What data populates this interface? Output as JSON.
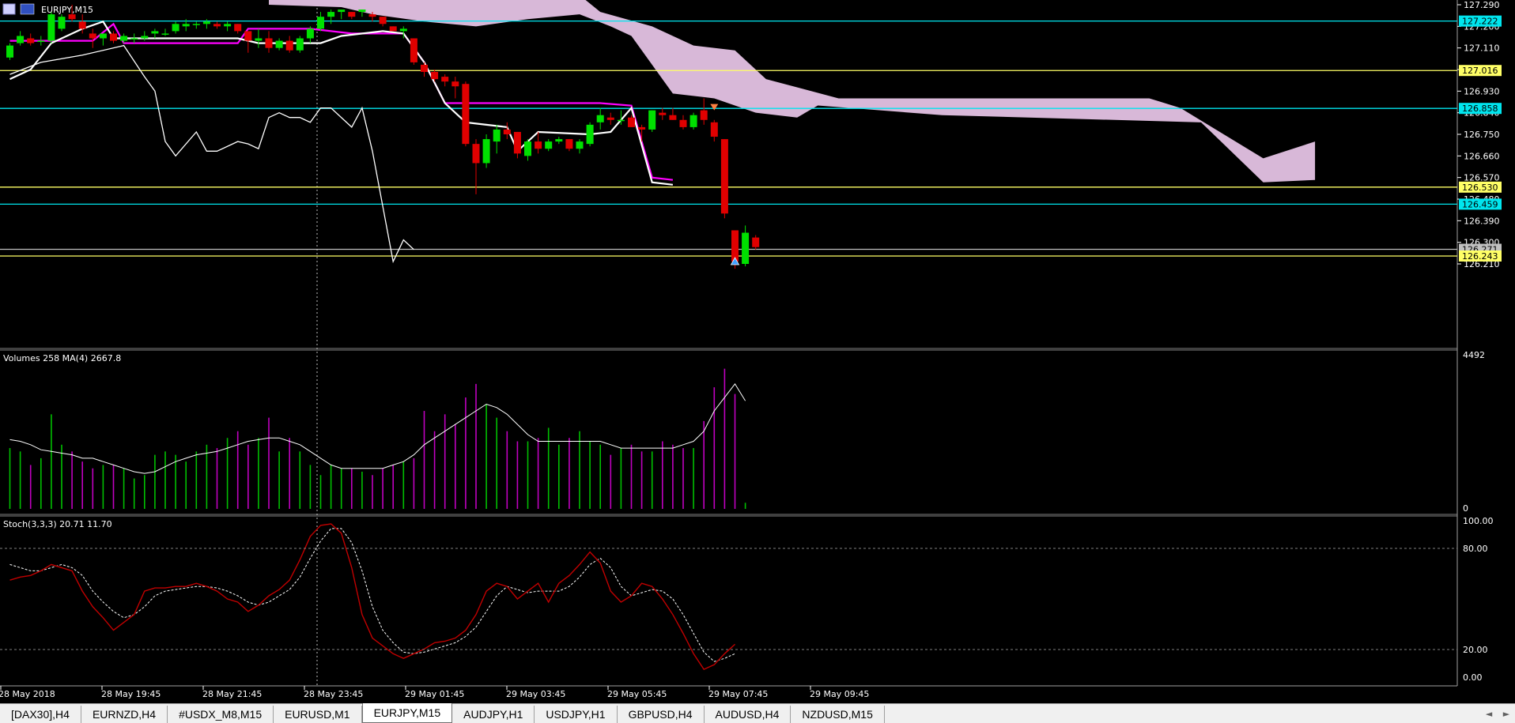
{
  "window": {
    "title": "EURJPY,M15"
  },
  "colors": {
    "bull": "#00e000",
    "bear": "#e00000",
    "kijun": "#ff00ff",
    "tenkan": "#ffffff",
    "chikou": "#ffffff",
    "cloud": "#d8b8d8",
    "cyan_level": "#00e5ee",
    "yellow_level": "#ffff66",
    "vol_bull": "#00c000",
    "vol_bear": "#c000c0",
    "stoch_main": "#c00000",
    "stoch_signal": "#ffffff"
  },
  "price_axis": {
    "ticks": [
      "127.290",
      "127.200",
      "127.110",
      "127.020",
      "126.930",
      "126.840",
      "126.750",
      "126.660",
      "126.570",
      "126.480",
      "126.390",
      "126.300",
      "126.210"
    ],
    "tags": [
      {
        "label": "127.222",
        "color": "#00e5ee"
      },
      {
        "label": "127.016",
        "color": "#ffff66"
      },
      {
        "label": "126.858",
        "color": "#00e5ee"
      },
      {
        "label": "126.530",
        "color": "#ffff66"
      },
      {
        "label": "126.459",
        "color": "#00e5ee"
      },
      {
        "label": "126.271",
        "color": "#c0c0c0"
      },
      {
        "label": "126.243",
        "color": "#ffff66"
      }
    ]
  },
  "volume_panel": {
    "label": "Volumes 258 MA(4) 2667.8",
    "max_label": "4492",
    "min_label": "0"
  },
  "stoch_panel": {
    "label": "Stoch(3,3,3) 20.71 11.70",
    "levels": [
      "100.00",
      "80.00",
      "20.00",
      "0.00"
    ]
  },
  "time_axis": [
    "28 May 2018",
    "28 May 19:45",
    "28 May 21:45",
    "28 May 23:45",
    "29 May 01:45",
    "29 May 03:45",
    "29 May 05:45",
    "29 May 07:45",
    "29 May 09:45"
  ],
  "tabs": [
    {
      "label": "[DAX30],H4",
      "active": false
    },
    {
      "label": "EURNZD,H4",
      "active": false
    },
    {
      "label": "#USDX_M8,M15",
      "active": false
    },
    {
      "label": "EURUSD,M1",
      "active": false
    },
    {
      "label": "EURJPY,M15",
      "active": true
    },
    {
      "label": "AUDJPY,H1",
      "active": false
    },
    {
      "label": "USDJPY,H1",
      "active": false
    },
    {
      "label": "GBPUSD,H4",
      "active": false
    },
    {
      "label": "AUDUSD,H4",
      "active": false
    },
    {
      "label": "NZDUSD,M15",
      "active": false
    }
  ],
  "tab_nav": {
    "left": "◄",
    "right": "►"
  },
  "chart_data": {
    "type": "candlestick",
    "title": "EURJPY,M15",
    "ylim": [
      126.17,
      127.33
    ],
    "candles": [
      {
        "o": 127.07,
        "h": 127.13,
        "l": 127.06,
        "c": 127.12
      },
      {
        "o": 127.13,
        "h": 127.18,
        "l": 127.12,
        "c": 127.16
      },
      {
        "o": 127.15,
        "h": 127.17,
        "l": 127.12,
        "c": 127.13
      },
      {
        "o": 127.14,
        "h": 127.16,
        "l": 127.12,
        "c": 127.14
      },
      {
        "o": 127.14,
        "h": 127.26,
        "l": 127.13,
        "c": 127.25
      },
      {
        "o": 127.19,
        "h": 127.25,
        "l": 127.18,
        "c": 127.24
      },
      {
        "o": 127.25,
        "h": 127.29,
        "l": 127.22,
        "c": 127.23
      },
      {
        "o": 127.22,
        "h": 127.25,
        "l": 127.17,
        "c": 127.19
      },
      {
        "o": 127.17,
        "h": 127.19,
        "l": 127.11,
        "c": 127.15
      },
      {
        "o": 127.15,
        "h": 127.17,
        "l": 127.12,
        "c": 127.17
      },
      {
        "o": 127.17,
        "h": 127.18,
        "l": 127.13,
        "c": 127.14
      },
      {
        "o": 127.14,
        "h": 127.17,
        "l": 127.13,
        "c": 127.16
      },
      {
        "o": 127.15,
        "h": 127.17,
        "l": 127.13,
        "c": 127.15
      },
      {
        "o": 127.15,
        "h": 127.18,
        "l": 127.14,
        "c": 127.16
      },
      {
        "o": 127.17,
        "h": 127.19,
        "l": 127.15,
        "c": 127.18
      },
      {
        "o": 127.17,
        "h": 127.19,
        "l": 127.16,
        "c": 127.17
      },
      {
        "o": 127.18,
        "h": 127.22,
        "l": 127.17,
        "c": 127.21
      },
      {
        "o": 127.2,
        "h": 127.23,
        "l": 127.18,
        "c": 127.21
      },
      {
        "o": 127.21,
        "h": 127.22,
        "l": 127.19,
        "c": 127.21
      },
      {
        "o": 127.21,
        "h": 127.23,
        "l": 127.19,
        "c": 127.22
      },
      {
        "o": 127.21,
        "h": 127.22,
        "l": 127.19,
        "c": 127.2
      },
      {
        "o": 127.2,
        "h": 127.22,
        "l": 127.18,
        "c": 127.21
      },
      {
        "o": 127.21,
        "h": 127.21,
        "l": 127.17,
        "c": 127.18
      },
      {
        "o": 127.18,
        "h": 127.18,
        "l": 127.09,
        "c": 127.14
      },
      {
        "o": 127.14,
        "h": 127.19,
        "l": 127.11,
        "c": 127.15
      },
      {
        "o": 127.15,
        "h": 127.18,
        "l": 127.09,
        "c": 127.11
      },
      {
        "o": 127.11,
        "h": 127.15,
        "l": 127.1,
        "c": 127.14
      },
      {
        "o": 127.14,
        "h": 127.16,
        "l": 127.09,
        "c": 127.1
      },
      {
        "o": 127.1,
        "h": 127.16,
        "l": 127.09,
        "c": 127.15
      },
      {
        "o": 127.15,
        "h": 127.2,
        "l": 127.13,
        "c": 127.19
      },
      {
        "o": 127.19,
        "h": 127.26,
        "l": 127.18,
        "c": 127.24
      },
      {
        "o": 127.24,
        "h": 127.27,
        "l": 127.21,
        "c": 127.26
      },
      {
        "o": 127.26,
        "h": 127.27,
        "l": 127.23,
        "c": 127.27
      },
      {
        "o": 127.26,
        "h": 127.26,
        "l": 127.23,
        "c": 127.24
      },
      {
        "o": 127.26,
        "h": 127.27,
        "l": 127.24,
        "c": 127.27
      },
      {
        "o": 127.25,
        "h": 127.26,
        "l": 127.22,
        "c": 127.24
      },
      {
        "o": 127.24,
        "h": 127.24,
        "l": 127.2,
        "c": 127.21
      },
      {
        "o": 127.2,
        "h": 127.2,
        "l": 127.18,
        "c": 127.18
      },
      {
        "o": 127.18,
        "h": 127.2,
        "l": 127.15,
        "c": 127.19
      },
      {
        "o": 127.15,
        "h": 127.15,
        "l": 127.04,
        "c": 127.05
      },
      {
        "o": 127.04,
        "h": 127.05,
        "l": 126.99,
        "c": 127.01
      },
      {
        "o": 127.01,
        "h": 127.02,
        "l": 126.97,
        "c": 126.98
      },
      {
        "o": 126.99,
        "h": 127.0,
        "l": 126.95,
        "c": 126.97
      },
      {
        "o": 126.97,
        "h": 126.99,
        "l": 126.9,
        "c": 126.95
      },
      {
        "o": 126.96,
        "h": 126.97,
        "l": 126.7,
        "c": 126.71
      },
      {
        "o": 126.71,
        "h": 126.73,
        "l": 126.5,
        "c": 126.63
      },
      {
        "o": 126.63,
        "h": 126.75,
        "l": 126.61,
        "c": 126.73
      },
      {
        "o": 126.72,
        "h": 126.79,
        "l": 126.67,
        "c": 126.77
      },
      {
        "o": 126.77,
        "h": 126.8,
        "l": 126.73,
        "c": 126.75
      },
      {
        "o": 126.76,
        "h": 126.76,
        "l": 126.65,
        "c": 126.67
      },
      {
        "o": 126.66,
        "h": 126.73,
        "l": 126.64,
        "c": 126.72
      },
      {
        "o": 126.72,
        "h": 126.76,
        "l": 126.67,
        "c": 126.69
      },
      {
        "o": 126.69,
        "h": 126.73,
        "l": 126.68,
        "c": 126.72
      },
      {
        "o": 126.72,
        "h": 126.74,
        "l": 126.71,
        "c": 126.73
      },
      {
        "o": 126.73,
        "h": 126.73,
        "l": 126.68,
        "c": 126.69
      },
      {
        "o": 126.69,
        "h": 126.73,
        "l": 126.67,
        "c": 126.72
      },
      {
        "o": 126.71,
        "h": 126.8,
        "l": 126.7,
        "c": 126.79
      },
      {
        "o": 126.8,
        "h": 126.86,
        "l": 126.77,
        "c": 126.83
      },
      {
        "o": 126.82,
        "h": 126.84,
        "l": 126.79,
        "c": 126.81
      },
      {
        "o": 126.81,
        "h": 126.85,
        "l": 126.79,
        "c": 126.81
      },
      {
        "o": 126.82,
        "h": 126.83,
        "l": 126.78,
        "c": 126.78
      },
      {
        "o": 126.78,
        "h": 126.79,
        "l": 126.72,
        "c": 126.77
      },
      {
        "o": 126.77,
        "h": 126.85,
        "l": 126.76,
        "c": 126.85
      },
      {
        "o": 126.84,
        "h": 126.86,
        "l": 126.81,
        "c": 126.83
      },
      {
        "o": 126.83,
        "h": 126.86,
        "l": 126.81,
        "c": 126.81
      },
      {
        "o": 126.81,
        "h": 126.83,
        "l": 126.77,
        "c": 126.78
      },
      {
        "o": 126.78,
        "h": 126.84,
        "l": 126.77,
        "c": 126.83
      },
      {
        "o": 126.85,
        "h": 126.9,
        "l": 126.79,
        "c": 126.81
      },
      {
        "o": 126.8,
        "h": 126.81,
        "l": 126.72,
        "c": 126.74
      },
      {
        "o": 126.73,
        "h": 126.73,
        "l": 126.4,
        "c": 126.42
      },
      {
        "o": 126.35,
        "h": 126.35,
        "l": 126.19,
        "c": 126.22
      },
      {
        "o": 126.21,
        "h": 126.37,
        "l": 126.2,
        "c": 126.34
      },
      {
        "o": 126.32,
        "h": 126.33,
        "l": 126.27,
        "c": 126.28
      }
    ],
    "volumes": [
      1800,
      1700,
      1300,
      1500,
      2800,
      1900,
      1700,
      1400,
      1200,
      1300,
      1300,
      1200,
      900,
      1000,
      1600,
      1700,
      1600,
      1400,
      1700,
      1900,
      1800,
      2100,
      2300,
      1900,
      2100,
      2700,
      1700,
      2100,
      1700,
      1300,
      1000,
      1300,
      1200,
      1200,
      1100,
      1000,
      1200,
      1300,
      1400,
      1500,
      2900,
      2300,
      2800,
      2500,
      3300,
      3700,
      3100,
      2700,
      2300,
      2000,
      2000,
      2100,
      2400,
      1900,
      2100,
      2300,
      2000,
      1900,
      1600,
      1800,
      1900,
      1700,
      1700,
      2000,
      1900,
      1800,
      1800,
      2600,
      3600,
      4150,
      3400,
      180
    ],
    "vol_ma": [
      2050,
      2000,
      1900,
      1750,
      1700,
      1650,
      1600,
      1500,
      1500,
      1400,
      1300,
      1200,
      1100,
      1050,
      1100,
      1250,
      1400,
      1500,
      1600,
      1650,
      1700,
      1800,
      1900,
      2000,
      2050,
      2100,
      2100,
      2000,
      1900,
      1700,
      1500,
      1300,
      1200,
      1200,
      1200,
      1200,
      1200,
      1300,
      1400,
      1600,
      1900,
      2100,
      2300,
      2500,
      2700,
      2900,
      3100,
      3000,
      2800,
      2500,
      2200,
      2000,
      2000,
      2000,
      2000,
      2000,
      2000,
      2000,
      1900,
      1800,
      1800,
      1800,
      1800,
      1800,
      1800,
      1900,
      2000,
      2300,
      2900,
      3300,
      3700,
      3200
    ],
    "stoch_main": [
      62,
      64,
      65,
      68,
      72,
      70,
      68,
      55,
      45,
      38,
      30,
      35,
      40,
      55,
      57,
      57,
      58,
      58,
      60,
      58,
      55,
      50,
      48,
      42,
      46,
      52,
      56,
      62,
      75,
      90,
      97,
      98,
      92,
      70,
      40,
      25,
      20,
      15,
      12,
      15,
      18,
      22,
      23,
      25,
      30,
      40,
      55,
      60,
      58,
      50,
      55,
      60,
      48,
      60,
      65,
      72,
      80,
      73,
      55,
      48,
      52,
      60,
      58,
      50,
      40,
      28,
      15,
      5,
      8,
      15,
      21
    ],
    "stoch_signal": [
      72,
      70,
      68,
      68,
      70,
      72,
      70,
      65,
      55,
      48,
      42,
      38,
      40,
      45,
      52,
      55,
      56,
      57,
      58,
      58,
      57,
      55,
      52,
      48,
      46,
      48,
      52,
      56,
      64,
      76,
      87,
      95,
      95,
      86,
      68,
      45,
      30,
      22,
      16,
      15,
      16,
      18,
      20,
      22,
      26,
      32,
      42,
      52,
      58,
      56,
      54,
      55,
      55,
      55,
      58,
      64,
      72,
      76,
      70,
      58,
      52,
      54,
      56,
      55,
      50,
      40,
      28,
      16,
      10,
      12,
      15
    ]
  }
}
